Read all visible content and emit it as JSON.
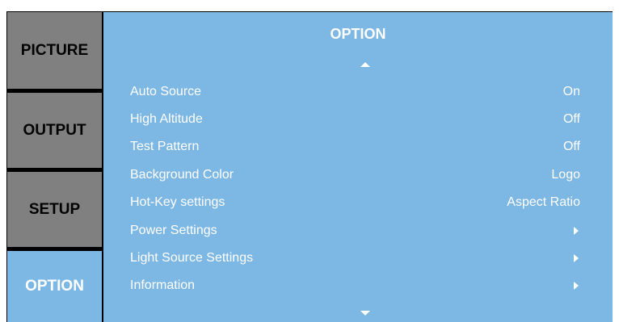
{
  "tabs": [
    {
      "label": "PICTURE",
      "active": false
    },
    {
      "label": "OUTPUT",
      "active": false
    },
    {
      "label": "SETUP",
      "active": false
    },
    {
      "label": "OPTION",
      "active": true
    }
  ],
  "panel": {
    "title": "OPTION",
    "scroll_up_icon": "triangle-up",
    "scroll_down_icon": "triangle-down",
    "items": [
      {
        "label": "Auto Source",
        "value": "On"
      },
      {
        "label": "High Altitude",
        "value": "Off"
      },
      {
        "label": "Test Pattern",
        "value": "Off"
      },
      {
        "label": "Background Color",
        "value": "Logo"
      },
      {
        "label": "Hot-Key settings",
        "value": "Aspect Ratio"
      },
      {
        "label": "Power Settings",
        "value": "",
        "icon": "submenu-arrow"
      },
      {
        "label": "Light Source Settings",
        "value": "",
        "icon": "submenu-arrow"
      },
      {
        "label": "Information",
        "value": "",
        "icon": "submenu-arrow"
      }
    ]
  },
  "colors": {
    "active_blue": "#7db7e3",
    "inactive_gray": "#808080",
    "border_black": "#000000",
    "text_white": "#ffffff"
  }
}
